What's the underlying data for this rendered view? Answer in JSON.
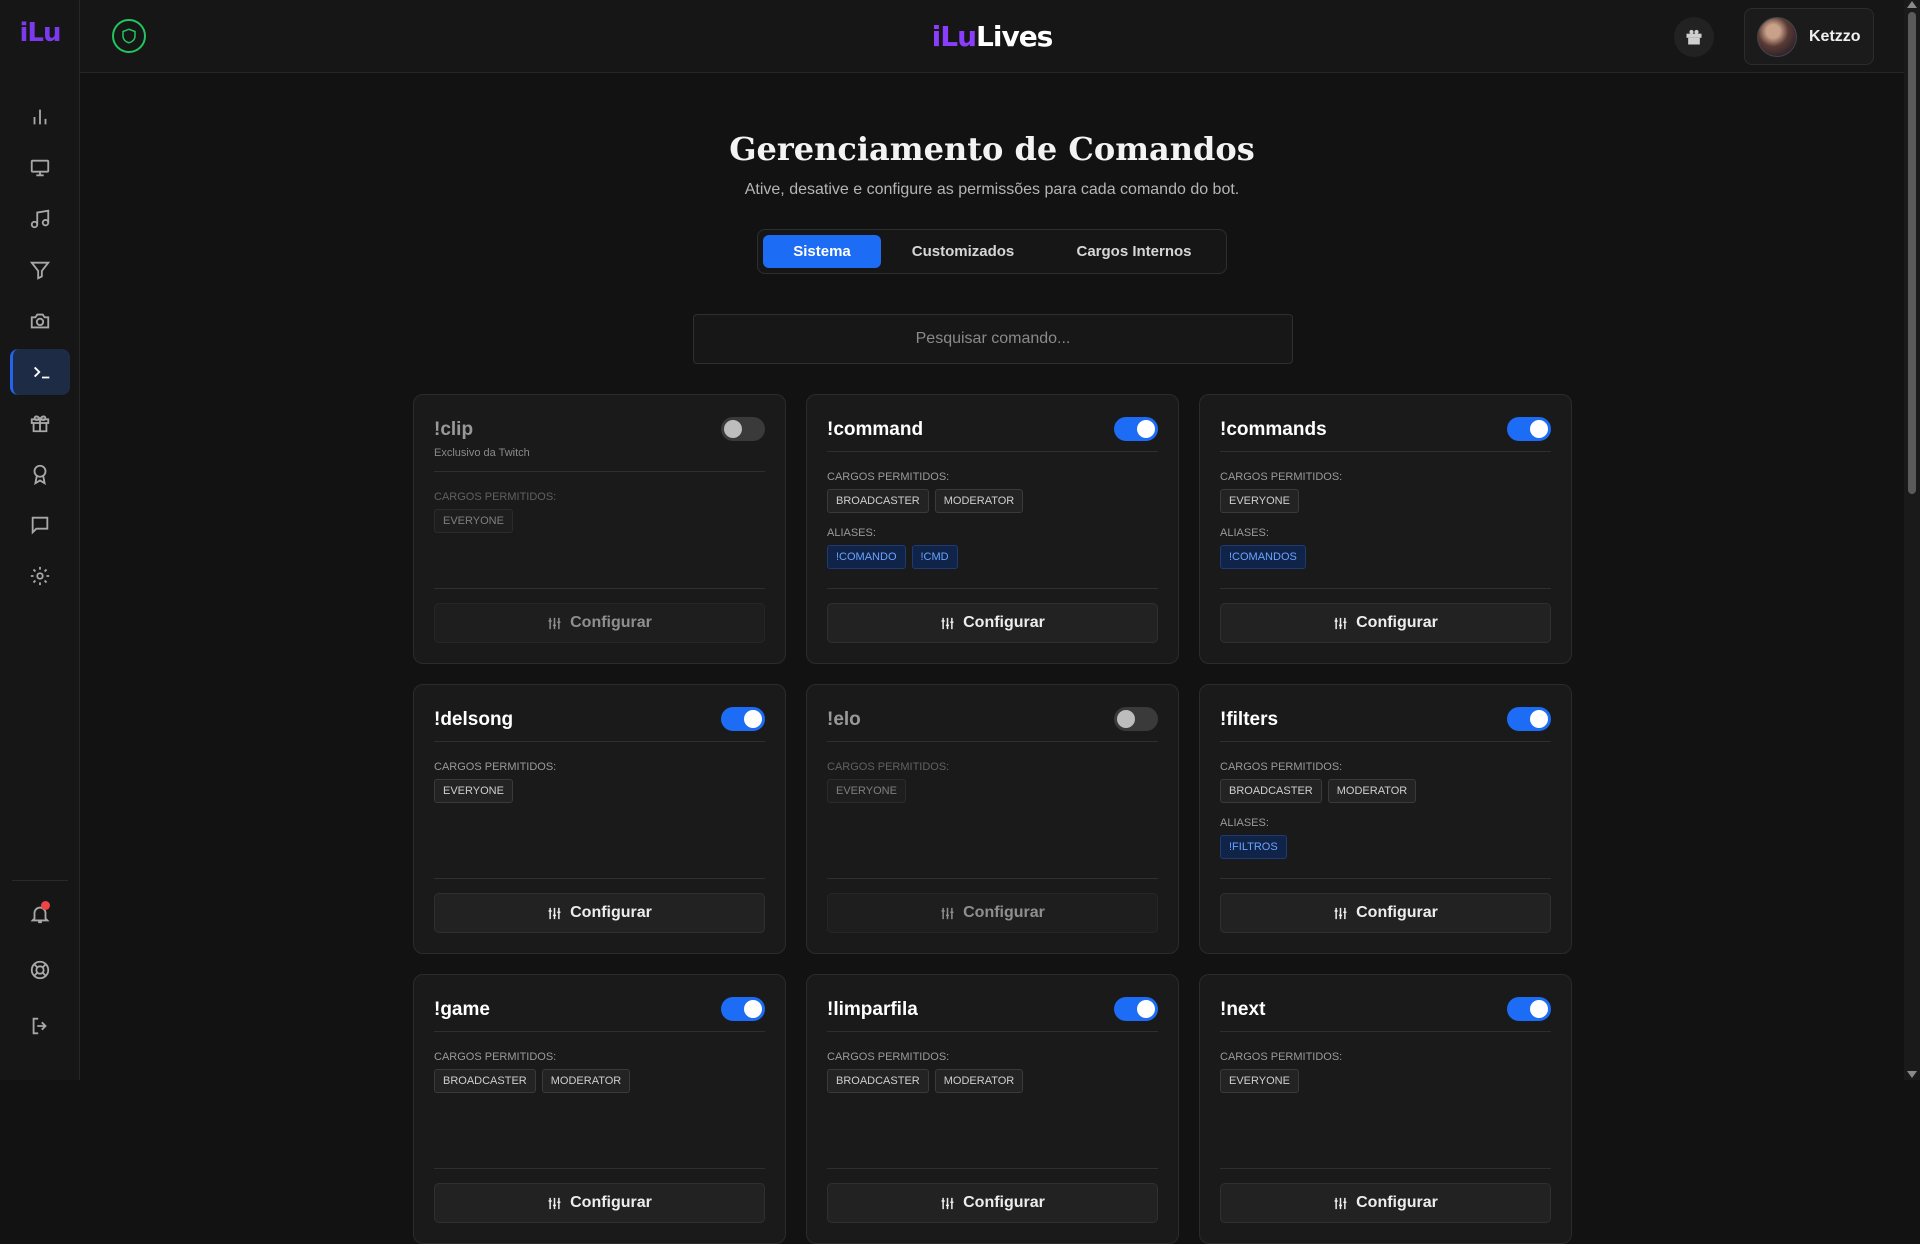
{
  "sidebar": {
    "logo": "iLu",
    "items": [
      {
        "name": "stats-icon"
      },
      {
        "name": "monitor-icon"
      },
      {
        "name": "music-icon"
      },
      {
        "name": "filter-icon"
      },
      {
        "name": "camera-icon"
      },
      {
        "name": "terminal-icon",
        "active": true
      },
      {
        "name": "gift-icon"
      },
      {
        "name": "award-icon"
      },
      {
        "name": "chat-icon"
      },
      {
        "name": "settings-icon"
      }
    ],
    "bottom": [
      {
        "name": "bell-icon"
      },
      {
        "name": "support-icon"
      },
      {
        "name": "logout-icon"
      }
    ]
  },
  "topbar": {
    "brand_a": "iLu",
    "brand_b": "Lives",
    "username": "Ketzzo"
  },
  "page": {
    "title": "Gerenciamento de Comandos",
    "subtitle": "Ative, desative e configure as permissões para cada comando do bot.",
    "tabs": [
      "Sistema",
      "Customizados",
      "Cargos Internos"
    ],
    "active_tab": "Sistema",
    "search_placeholder": "Pesquisar comando..."
  },
  "labels": {
    "roles": "CARGOS PERMITIDOS:",
    "aliases": "ALIASES:",
    "configure": "Configurar"
  },
  "commands": [
    {
      "name": "!clip",
      "note": "Exclusivo da Twitch",
      "enabled": false,
      "roles": [
        "EVERYONE"
      ],
      "aliases": []
    },
    {
      "name": "!command",
      "enabled": true,
      "roles": [
        "BROADCASTER",
        "MODERATOR"
      ],
      "aliases": [
        "!COMANDO",
        "!CMD"
      ]
    },
    {
      "name": "!commands",
      "enabled": true,
      "roles": [
        "EVERYONE"
      ],
      "aliases": [
        "!COMANDOS"
      ]
    },
    {
      "name": "!delsong",
      "enabled": true,
      "roles": [
        "EVERYONE"
      ],
      "aliases": []
    },
    {
      "name": "!elo",
      "enabled": false,
      "roles": [
        "EVERYONE"
      ],
      "aliases": []
    },
    {
      "name": "!filters",
      "enabled": true,
      "roles": [
        "BROADCASTER",
        "MODERATOR"
      ],
      "aliases": [
        "!FILTROS"
      ]
    },
    {
      "name": "!game",
      "enabled": true,
      "roles": [
        "BROADCASTER",
        "MODERATOR"
      ],
      "aliases": []
    },
    {
      "name": "!limparfila",
      "enabled": true,
      "roles": [
        "BROADCASTER",
        "MODERATOR"
      ],
      "aliases": []
    },
    {
      "name": "!next",
      "enabled": true,
      "roles": [
        "EVERYONE"
      ],
      "aliases": []
    }
  ],
  "colors": {
    "accent": "#1d6cf5",
    "brand": "#8b3dff",
    "shield": "#22c55e"
  }
}
